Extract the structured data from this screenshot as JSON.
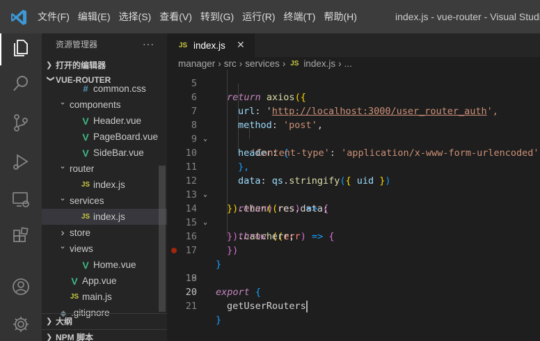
{
  "menu": [
    "文件(F)",
    "编辑(E)",
    "选择(S)",
    "查看(V)",
    "转到(G)",
    "运行(R)",
    "终端(T)",
    "帮助(H)"
  ],
  "window_title": "index.js - vue-router - Visual Studio C",
  "sidebar": {
    "title": "资源管理器",
    "more": "···",
    "open_editors": "打开的编辑器",
    "project": "VUE-ROUTER",
    "tree": [
      {
        "label": "common.css",
        "icon": "#",
        "type": "css",
        "depth": 2
      },
      {
        "label": "components",
        "icon": "",
        "type": "folder-open",
        "depth": 1
      },
      {
        "label": "Header.vue",
        "icon": "V",
        "type": "vue",
        "depth": 2
      },
      {
        "label": "PageBoard.vue",
        "icon": "V",
        "type": "vue",
        "depth": 2
      },
      {
        "label": "SideBar.vue",
        "icon": "V",
        "type": "vue",
        "depth": 2
      },
      {
        "label": "router",
        "icon": "",
        "type": "folder-open",
        "depth": 1
      },
      {
        "label": "index.js",
        "icon": "JS",
        "type": "js",
        "depth": 2
      },
      {
        "label": "services",
        "icon": "",
        "type": "folder-open",
        "depth": 1
      },
      {
        "label": "index.js",
        "icon": "JS",
        "type": "js",
        "depth": 2,
        "selected": true
      },
      {
        "label": "store",
        "icon": "",
        "type": "folder-closed",
        "depth": 1
      },
      {
        "label": "views",
        "icon": "",
        "type": "folder-open",
        "depth": 1
      },
      {
        "label": "Home.vue",
        "icon": "V",
        "type": "vue",
        "depth": 2
      },
      {
        "label": "App.vue",
        "icon": "V",
        "type": "vue",
        "depth": 1
      },
      {
        "label": "main.js",
        "icon": "JS",
        "type": "js",
        "depth": 1
      },
      {
        "label": ".gitignore",
        "icon": "◆",
        "type": "dot",
        "depth": 0
      }
    ],
    "outline": "大纲",
    "npm": "NPM 脚本"
  },
  "tab": {
    "icon": "JS",
    "label": "index.js",
    "close": "✕"
  },
  "breadcrumb": [
    "manager",
    "src",
    "services",
    "index.js",
    "..."
  ],
  "breadcrumb_icon": "JS",
  "editor": {
    "line_numbers": [
      "5",
      "6",
      "7",
      "8",
      "9",
      "10",
      "11",
      "12",
      "13",
      "14",
      "15",
      "16",
      "17",
      "18",
      "19",
      "20",
      "21"
    ],
    "tokens": {
      "l5_return": "return",
      "l5_axios": "axios",
      "l5_open": "({",
      "l6_key": "url",
      "l6_colon": ": '",
      "l6_url": "http://localhost:3000/user_router_auth",
      "l6_end": "',",
      "l7_key": "method",
      "l7_colon": ": ",
      "l7_val": "'post'",
      "l7_end": ",",
      "l8_key": "header",
      "l8_colon": ": ",
      "l8_brace": "{",
      "l9_key": "'Content-type'",
      "l9_colon": ": ",
      "l9_val": "'application/x-www-form-urlencoded'",
      "l10_brace": "},",
      "l11_key": "data",
      "l11_colon": ": ",
      "l11_obj": "qs",
      "l11_dot": ".",
      "l11_fn": "stringify",
      "l11_p1": "(",
      "l11_b1": "{",
      "l11_uid": " uid ",
      "l11_b2": "}",
      "l11_p2": ")",
      "l12_close": "})",
      "l12_dot": ".",
      "l12_fn": "then",
      "l12_p1": "((",
      "l12_arg": "res",
      "l12_p2": ")",
      "l12_arrow": " => ",
      "l12_brace": "{",
      "l13_return": "return",
      "l13_rest": " res.data;",
      "l14_close": "})",
      "l14_dot": ".",
      "l14_fn": "catch",
      "l14_p1": "((",
      "l14_arg": "err",
      "l14_p2": ")",
      "l14_arrow": " => ",
      "l14_brace": "{",
      "l15_throw": "throw",
      "l15_rest": " err;",
      "l16_close": "})",
      "l17_close": "}",
      "l19_export": "export",
      "l19_brace": " {",
      "l20_ident": "getUserRouters",
      "l21_close": "}"
    }
  },
  "colors": {
    "title_bar": "#3c3c3c",
    "activity_bar": "#333333",
    "sidebar": "#252526",
    "editor": "#1e1e1e",
    "vscode_blue": "#3c99d4"
  }
}
